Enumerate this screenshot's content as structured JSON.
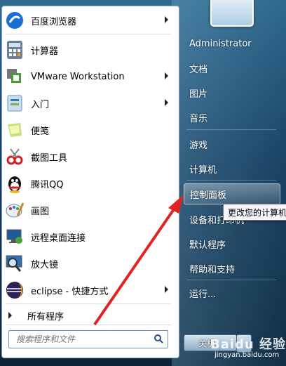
{
  "left_items": [
    {
      "label": "百度浏览器",
      "icon": "baidu-browser-icon",
      "has_submenu": true
    },
    {
      "label": "计算器",
      "icon": "calculator-icon",
      "has_submenu": false
    },
    {
      "label": "VMware Workstation",
      "icon": "vmware-icon",
      "has_submenu": true
    },
    {
      "label": "入门",
      "icon": "getting-started-icon",
      "has_submenu": true
    },
    {
      "label": "便笺",
      "icon": "sticky-notes-icon",
      "has_submenu": false
    },
    {
      "label": "截图工具",
      "icon": "snipping-tool-icon",
      "has_submenu": false
    },
    {
      "label": "腾讯QQ",
      "icon": "qq-icon",
      "has_submenu": false
    },
    {
      "label": "画图",
      "icon": "paint-icon",
      "has_submenu": false
    },
    {
      "label": "远程桌面连接",
      "icon": "remote-desktop-icon",
      "has_submenu": false
    },
    {
      "label": "放大镜",
      "icon": "magnifier-icon",
      "has_submenu": false
    },
    {
      "label": "eclipse - 快捷方式",
      "icon": "eclipse-icon",
      "has_submenu": true
    }
  ],
  "all_programs": "所有程序",
  "search": {
    "placeholder": "搜索程序和文件"
  },
  "right_items": [
    {
      "label": "Administrator"
    },
    {
      "label": "文档"
    },
    {
      "label": "图片"
    },
    {
      "label": "音乐"
    },
    {
      "label": "游戏"
    },
    {
      "label": "计算机"
    },
    {
      "label": "控制面板",
      "highlighted": true
    },
    {
      "label": "设备和打印机"
    },
    {
      "label": "默认程序"
    },
    {
      "label": "帮助和支持"
    },
    {
      "label": "运行..."
    }
  ],
  "tooltip": "更改您的计算机",
  "shutdown": "关机",
  "watermark": {
    "text": "Baidu 经验",
    "sub": "jingyan.baidu.com"
  },
  "colors": {
    "accent_arrow": "#e02424",
    "highlight": "#ffffff"
  }
}
